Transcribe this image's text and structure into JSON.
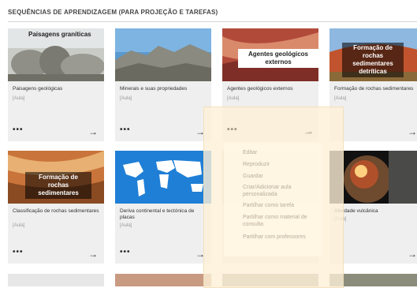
{
  "section": {
    "title": "SEQUÊNCIAS DE APRENDIZAGEM (PARA PROJEÇÃO E TAREFAS)"
  },
  "cards": [
    {
      "title": "Paisagens geológicas",
      "type": "[Aula]",
      "overlay": "Paisagens graníticas"
    },
    {
      "title": "Minerais e suas propriedades",
      "type": "[Aula]",
      "overlay": ""
    },
    {
      "title": "Agentes geológicos externos",
      "type": "[Aula]",
      "overlay": "Agentes geológicos externos"
    },
    {
      "title": "Formação de rochas sedimentares",
      "type": "[Aula]",
      "overlay": "Formação de rochas sedimentares detríticas"
    },
    {
      "title": "Classificação de rochas sedimentares",
      "type": "[Aula]",
      "overlay": "Formação de rochas sedimentares"
    },
    {
      "title": "Deriva continental e tectónica de placas",
      "type": "[Aula]",
      "overlay": ""
    },
    {
      "title": "",
      "type": "",
      "overlay": ""
    },
    {
      "title": "Atividade vulcânica",
      "type": "[Aula]",
      "overlay": ""
    }
  ],
  "more_label": "•••",
  "open_arrow": "→",
  "context_menu": {
    "items": [
      "Editar",
      "Reproduzir",
      "Guardar",
      "Criar/Adicionar aula personalizada",
      "Partilhar como tarefa",
      "Partilhar como material de consulta",
      "Partilhar com professores"
    ]
  },
  "colors": {
    "menu_text": "#b9ad98",
    "card_bg": "#efefef",
    "highlight": "#fcf0d7"
  }
}
